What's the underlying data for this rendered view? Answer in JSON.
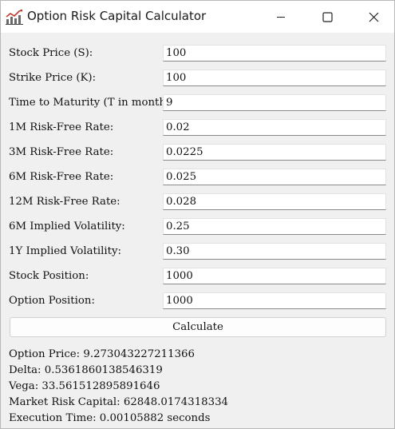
{
  "window": {
    "title": "Option Risk Capital Calculator"
  },
  "form": {
    "fields": [
      {
        "label": "Stock Price (S):",
        "value": "100"
      },
      {
        "label": "Strike Price (K):",
        "value": "100"
      },
      {
        "label": "Time to Maturity (T in months):",
        "value": "9"
      },
      {
        "label": "1M Risk-Free Rate:",
        "value": "0.02"
      },
      {
        "label": "3M Risk-Free Rate:",
        "value": "0.0225"
      },
      {
        "label": "6M Risk-Free Rate:",
        "value": "0.025"
      },
      {
        "label": "12M Risk-Free Rate:",
        "value": "0.028"
      },
      {
        "label": "6M Implied Volatility:",
        "value": "0.25"
      },
      {
        "label": "1Y Implied Volatility:",
        "value": "0.30"
      },
      {
        "label": "Stock Position:",
        "value": "1000"
      },
      {
        "label": "Option Position:",
        "value": "1000"
      }
    ],
    "calculate_label": "Calculate"
  },
  "results": {
    "option_price": "Option Price: 9.273043227211366",
    "delta": "Delta: 0.5361860138546319",
    "vega": "Vega: 33.561512895891646",
    "market_risk_capital": "Market Risk Capital: 62848.0174318334",
    "execution_time": "Execution Time: 0.00105882 seconds"
  },
  "icons": {
    "app": "chart-app-icon",
    "minimize": "minimize-icon",
    "maximize": "maximize-icon",
    "close": "close-icon"
  }
}
